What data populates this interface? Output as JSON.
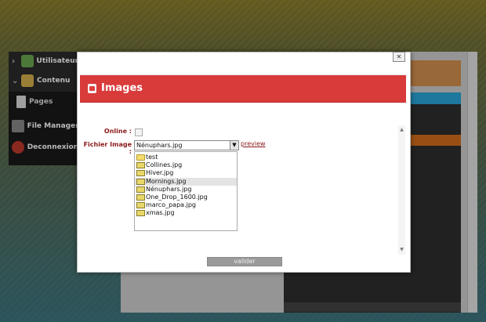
{
  "sidebar": {
    "items": [
      {
        "label": "Utilisateur",
        "icon": "users-icon",
        "chevron": "›"
      },
      {
        "label": "Contenu",
        "icon": "content-icon",
        "chevron": "⌄"
      },
      {
        "label": "Pages",
        "icon": "page-icon"
      },
      {
        "label": "File Manager",
        "icon": "drive-icon"
      },
      {
        "label": "Deconnexion",
        "icon": "power-icon"
      }
    ]
  },
  "modal": {
    "close_label": "✕",
    "title": "Images",
    "online_label": "Online :",
    "file_label": "Fichier Image :",
    "selected_file": "Nénuphars.jpg",
    "preview_label": "preview",
    "files": [
      {
        "name": "test",
        "type": "folder"
      },
      {
        "name": "Collines.jpg",
        "type": "image"
      },
      {
        "name": "Hiver.jpg",
        "type": "image"
      },
      {
        "name": "Mornings.jpg",
        "type": "image",
        "selected": true
      },
      {
        "name": "Nénuphars.jpg",
        "type": "image"
      },
      {
        "name": "One_Drop_1600.jpg",
        "type": "image"
      },
      {
        "name": "marco_papa.jpg",
        "type": "image"
      },
      {
        "name": "xmas.jpg",
        "type": "image"
      }
    ],
    "submit_label": "valider"
  },
  "colors": {
    "title_bar": "#d93a3a",
    "label": "#8b1a1a",
    "sidebar": "#2b2b2b"
  }
}
